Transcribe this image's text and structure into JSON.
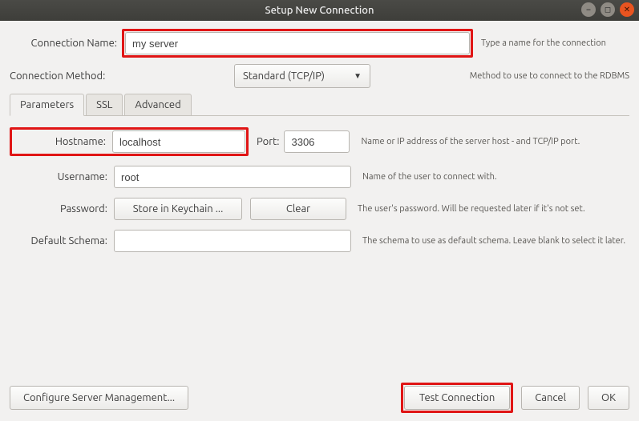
{
  "title": "Setup New Connection",
  "top": {
    "conn_name_label": "Connection Name:",
    "conn_name_value": "my server",
    "conn_name_hint": "Type a name for the connection",
    "method_label": "Connection Method:",
    "method_value": "Standard (TCP/IP)",
    "method_hint": "Method to use to connect to the RDBMS"
  },
  "tabs": {
    "t0": "Parameters",
    "t1": "SSL",
    "t2": "Advanced"
  },
  "params": {
    "hostname_label": "Hostname:",
    "hostname_value": "localhost",
    "port_label": "Port:",
    "port_value": "3306",
    "host_hint": "Name or IP address of the server host - and TCP/IP port.",
    "username_label": "Username:",
    "username_value": "root",
    "username_hint": "Name of the user to connect with.",
    "password_label": "Password:",
    "store_btn": "Store in Keychain ...",
    "clear_btn": "Clear",
    "password_hint": "The user's password. Will be requested later if it's not set.",
    "schema_label": "Default Schema:",
    "schema_value": "",
    "schema_hint": "The schema to use as default schema. Leave blank to select it later."
  },
  "footer": {
    "config_btn": "Configure Server Management...",
    "test_btn": "Test Connection",
    "cancel_btn": "Cancel",
    "ok_btn": "OK"
  }
}
